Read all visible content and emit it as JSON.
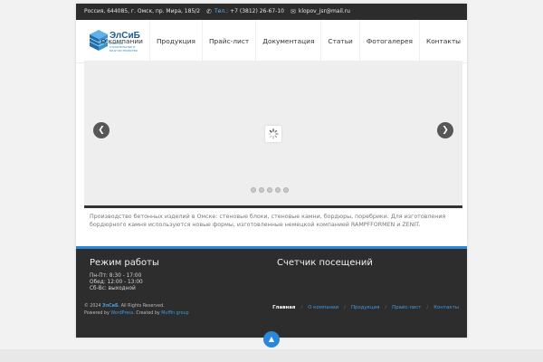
{
  "topbar": {
    "address": "Россия, 644085, г. Омск, пр. Мира, 185/2",
    "phone_label": "Тел.:",
    "phone": "+7 (3812) 26-67-10",
    "email": "klopov_jsr@mail.ru"
  },
  "logo": {
    "name": "ЭлСиБ",
    "tagline": "ИЗДЕЛИЯ СТРОИТЕЛЬНЫЕ И БЛАГОУСТРОЙСТВО"
  },
  "nav": {
    "items": [
      "О компании",
      "Продукция",
      "Прайс-лист",
      "Документация",
      "Статьи",
      "Фотогалерея",
      "Контакты"
    ]
  },
  "slider": {
    "prev_icon": "chevron-left-icon",
    "next_icon": "chevron-right-icon",
    "dot_count": 5
  },
  "description": "Производство бетонных изделий в Омске: стеновые блоки, стеновые камни, бордюры, поребрики. Для изготовления бордюрного камня используются новые формы, изготовленные немецкой компанией RAMPFFORMEN и ZENIT.",
  "footer": {
    "hours_title": "Режим работы",
    "hours": [
      "Пн-Пт: 8:30 - 17:00",
      "Обед: 12:00 - 13:00",
      "Сб-Вс: выходной"
    ],
    "counter_title": "Счетчик посещений",
    "copyright_prefix": "© 2024",
    "brand": "ЭлСиБ",
    "rights": ". All Rights Reserved.",
    "powered_prefix": "Powered by",
    "powered_link": "WordPress",
    "created_prefix": ". Created by",
    "created_link": "Muffin group",
    "nav": [
      "Главная",
      "О компании",
      "Продукция",
      "Прайс-лист",
      "Контакты"
    ]
  },
  "colors": {
    "accent": "#2a88d8",
    "topbar_bg": "#2c2c2c",
    "footer_bg": "#2d2d2d"
  }
}
